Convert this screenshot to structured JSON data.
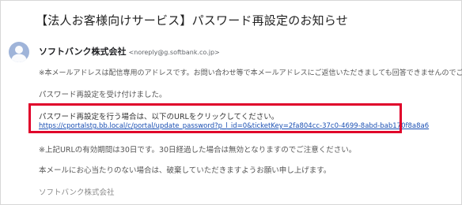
{
  "email": {
    "subject": "【法人お客様向けサービス】パスワード再設定のお知らせ",
    "sender": {
      "name": "ソフトバンク株式会社",
      "address": "<noreply@g.softbank.co.jp>",
      "avatar_icon": "person-icon"
    },
    "body": {
      "notice": "※本メールアドレスは配信専用のアドレスです。お問い合わせ等で本メールアドレスにご返信いただきましても回答できませんのでご了",
      "received": "パスワード再設定を受け付けました。",
      "reset_instruction": "パスワード再設定を行う場合は、以下のURLをクリックしてください。",
      "reset_url": "https://cportalstg.bb.local/c/portal/update_password?p_l_id=0&ticketKey=2fa804cc-37c0-4699-8abd-bab170f8a8a6",
      "expiry": "※上記URLの有効期間は30日です。30日経過した場合は無効となりますのでご注意ください。",
      "ignore": "本メールにお心当たりのない場合は、破棄していただきますようお願い申し上げます。",
      "signature": "ソフトバンク株式会社"
    }
  },
  "colors": {
    "highlight": "#e0002a",
    "link": "#1a4fb3",
    "avatar": "#9fb4d9"
  }
}
